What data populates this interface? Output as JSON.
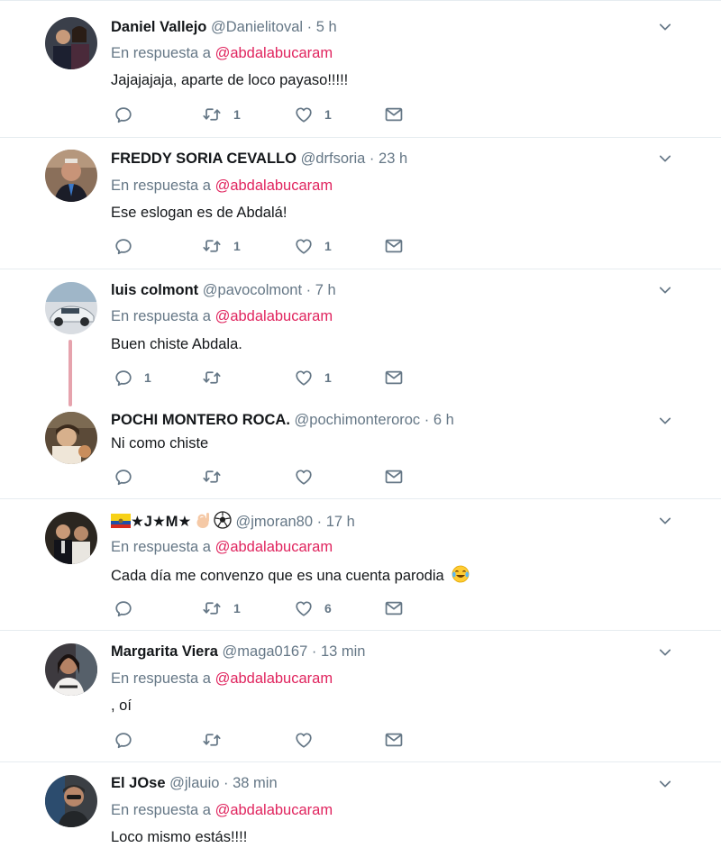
{
  "tweets": [
    {
      "name": "Daniel Vallejo",
      "handle": "@Danielitoval",
      "sep": " · ",
      "time": "5 h",
      "reply_prefix": "En respuesta a ",
      "reply_mention": "@abdalabucaram",
      "text": "Jajajajaja, aparte de loco payaso!!!!!",
      "replies": "",
      "retweets": "1",
      "likes": "1"
    },
    {
      "name": "FREDDY SORIA CEVALLO",
      "handle": "@drfsoria",
      "sep": " · ",
      "time": "23 h",
      "reply_prefix": "En respuesta a ",
      "reply_mention": "@abdalabucaram",
      "text": "Ese eslogan es de Abdalá!",
      "replies": "",
      "retweets": "1",
      "likes": "1"
    },
    {
      "name": "luis colmont",
      "handle": "@pavocolmont",
      "sep": " · ",
      "time": "7 h",
      "reply_prefix": "En respuesta a ",
      "reply_mention": "@abdalabucaram",
      "text": "Buen chiste Abdala.",
      "replies": "1",
      "retweets": "",
      "likes": "1"
    },
    {
      "name": "POCHI MONTERO ROCA.",
      "handle": "@pochimonteroroc",
      "sep": " · ",
      "time": "6 h",
      "text": "Ni como chiste",
      "replies": "",
      "retweets": "",
      "likes": ""
    },
    {
      "name": "★J★M★",
      "handle": "@jmoran80",
      "sep": " · ",
      "time": "17 h",
      "reply_prefix": "En respuesta a ",
      "reply_mention": "@abdalabucaram",
      "text": "Cada día me convenzo que es una cuenta parodia",
      "replies": "",
      "retweets": "1",
      "likes": "6"
    },
    {
      "name": "Margarita Viera",
      "handle": "@maga0167",
      "sep": " · ",
      "time": "13 min",
      "reply_prefix": "En respuesta a ",
      "reply_mention": "@abdalabucaram",
      "text": ", oí",
      "replies": "",
      "retweets": "",
      "likes": ""
    },
    {
      "name": "El JOse",
      "handle": "@jlauio",
      "sep": " · ",
      "time": "38 min",
      "reply_prefix": "En respuesta a ",
      "reply_mention": "@abdalabucaram",
      "text": "Loco mismo estás!!!!",
      "replies": "",
      "retweets": "",
      "likes": ""
    }
  ],
  "icons": {
    "reply": "reply-icon",
    "retweet": "retweet-icon",
    "like": "heart-icon",
    "dm": "envelope-icon",
    "caret": "chevron-down-icon",
    "name_emojis": [
      "ecuador-flag-emoji",
      "ok-hand-emoji",
      "soccer-ball-emoji"
    ],
    "text_emoji": "laughing-tears-emoji"
  },
  "colors": {
    "mention": "#e0245e",
    "secondary": "#657786",
    "divider": "#e6ecf0",
    "thread": "#e6a3ad"
  }
}
